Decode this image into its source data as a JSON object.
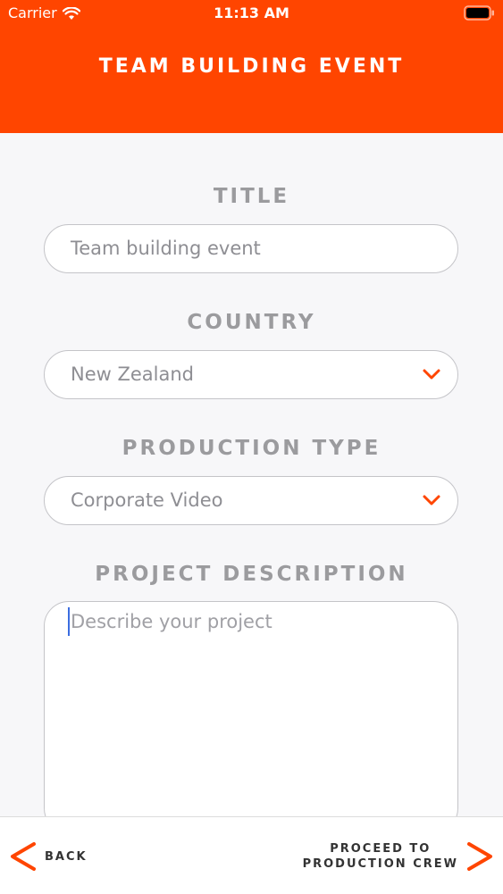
{
  "status_bar": {
    "carrier": "Carrier",
    "time": "11:13 AM"
  },
  "header": {
    "title": "TEAM BUILDING EVENT",
    "background_color": "#ff4500"
  },
  "form": {
    "title": {
      "label": "TITLE",
      "value": "Team building event"
    },
    "country": {
      "label": "COUNTRY",
      "value": "New Zealand"
    },
    "production_type": {
      "label": "PRODUCTION TYPE",
      "value": "Corporate Video"
    },
    "project_description": {
      "label": "PROJECT DESCRIPTION",
      "placeholder": "Describe your project"
    }
  },
  "footer": {
    "back_label": "BACK",
    "proceed_line1": "PROCEED TO",
    "proceed_line2": "PRODUCTION CREW"
  },
  "colors": {
    "accent": "#ff4500",
    "label_gray": "#9b9b9e",
    "caret_blue": "#3b6de0"
  },
  "icons": {
    "wifi": "wifi-icon",
    "battery": "battery-icon",
    "dropdown": "chevron-down-icon",
    "back": "chevron-left-icon",
    "forward": "chevron-right-icon"
  }
}
